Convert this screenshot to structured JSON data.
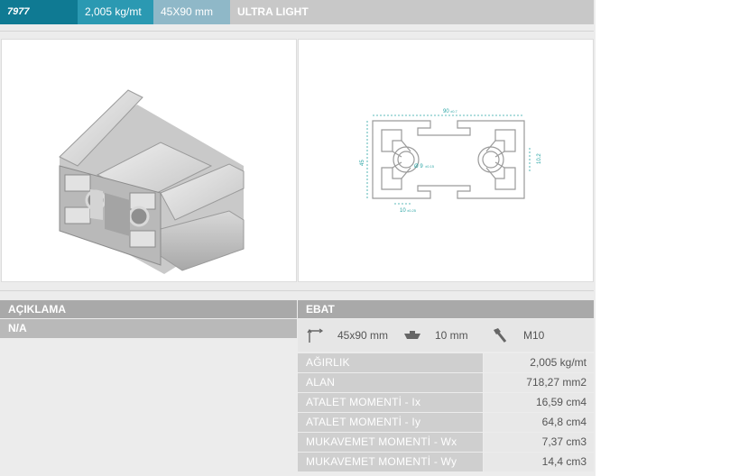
{
  "header": {
    "code": "7977",
    "weight": "2,005 kg/mt",
    "dimension": "45X90 mm",
    "type": "ULTRA LIGHT"
  },
  "drawing": {
    "width_label": "90",
    "width_tol": "±0.7",
    "height_label": "45",
    "height_tol": "±0.5",
    "bore_label": "Ø 9",
    "bore_tol": "±0.15",
    "right_label": "10.2",
    "right_tol": "±0.25",
    "slot_label": "10",
    "slot_tol": "±0.25"
  },
  "description": {
    "heading": "AÇIKLAMA",
    "value": "N/A"
  },
  "ebat": {
    "heading": "EBAT",
    "size": "45x90 mm",
    "slot": "10 mm",
    "bolt": "M10"
  },
  "properties": [
    {
      "label": "AĞIRLIK",
      "value": "2,005 kg/mt"
    },
    {
      "label": "ALAN",
      "value": "718,27 mm2"
    },
    {
      "label": "ATALET MOMENTİ - Ix",
      "value": "16,59 cm4"
    },
    {
      "label": "ATALET MOMENTİ - Iy",
      "value": "64,8 cm4"
    },
    {
      "label": "MUKAVEMET MOMENTİ - Wx",
      "value": "7,37 cm3"
    },
    {
      "label": "MUKAVEMET MOMENTİ - Wy",
      "value": "14,4 cm3"
    }
  ],
  "colors": {
    "code_bg": "#0f7a93",
    "weight_bg": "#2b99b2",
    "dimension_bg": "#8fb8c8",
    "dimension_line": "#2ba5a5"
  },
  "icons": {
    "size": "dimension-arrows-icon",
    "slot": "t-nut-icon",
    "bolt": "bolt-icon"
  }
}
